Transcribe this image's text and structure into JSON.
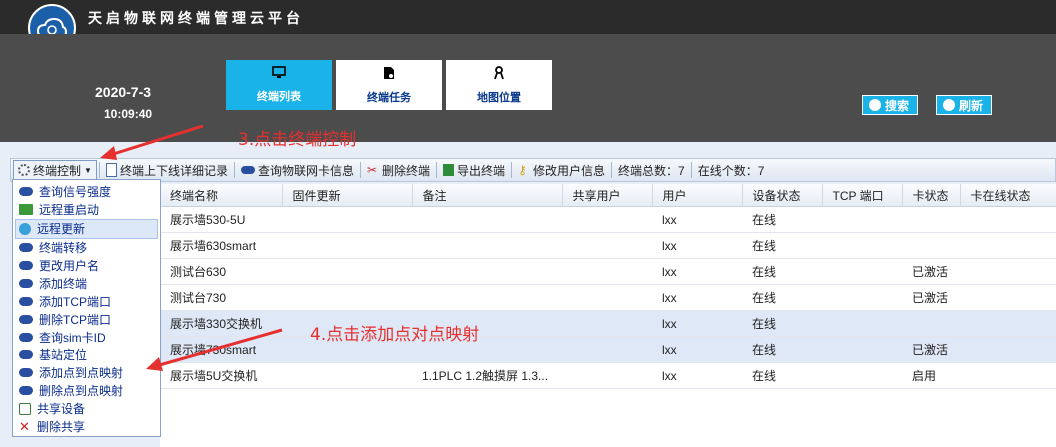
{
  "app": {
    "title": "天启物联网终端管理云平台",
    "date": "2020-7-3",
    "time": "10:09:40"
  },
  "nav": {
    "tabs": [
      {
        "label": "终端列表",
        "icon": "monitor-icon"
      },
      {
        "label": "终端任务",
        "icon": "document-icon"
      },
      {
        "label": "地图位置",
        "icon": "person-pin-icon"
      }
    ]
  },
  "header_buttons": {
    "search": "搜索",
    "refresh": "刷新"
  },
  "annotations": {
    "step3": "3.点击终端控制",
    "step4": "4.点击添加点对点映射"
  },
  "toolbar": {
    "terminal_control": "终端控制",
    "log": "终端上下线详细记录",
    "query_sim": "查询物联网卡信息",
    "delete": "删除终端",
    "export": "导出终端",
    "modify_user": "修改用户信息",
    "total": "终端总数：7",
    "online": "在线个数：7"
  },
  "menu": {
    "items": [
      "查询信号强度",
      "远程重启动",
      "远程更新",
      "终端转移",
      "更改用户名",
      "添加终端",
      "添加TCP端口",
      "删除TCP端口",
      "查询sim卡ID",
      "基站定位",
      "添加点到点映射",
      "删除点到点映射",
      "共享设备",
      "删除共享"
    ]
  },
  "table": {
    "columns": [
      "终端名称",
      "固件更新",
      "备注",
      "共享用户",
      "用户",
      "设备状态",
      "TCP 端口",
      "卡状态",
      "卡在线状态"
    ],
    "rows": [
      [
        "展示墙530-5U",
        "",
        "",
        "",
        "lxx",
        "在线",
        "",
        "",
        ""
      ],
      [
        "展示墙630smart",
        "",
        "",
        "",
        "lxx",
        "在线",
        "",
        "",
        ""
      ],
      [
        "测试台630",
        "",
        "",
        "",
        "lxx",
        "在线",
        "",
        "已激活",
        ""
      ],
      [
        "测试台730",
        "",
        "",
        "",
        "lxx",
        "在线",
        "",
        "已激活",
        ""
      ],
      [
        "展示墙330交换机",
        "",
        "",
        "",
        "lxx",
        "在线",
        "",
        "",
        ""
      ],
      [
        "展示墙730smart",
        "",
        "",
        "",
        "lxx",
        "在线",
        "",
        "已激活",
        ""
      ],
      [
        "展示墙5U交换机",
        "",
        "1.1PLC 1.2触摸屏 1.3...",
        "",
        "lxx",
        "在线",
        "",
        "启用",
        ""
      ]
    ]
  },
  "colors": {
    "accent": "#19b3e8",
    "annotation": "#e53030",
    "header": "#4c4c4c"
  }
}
